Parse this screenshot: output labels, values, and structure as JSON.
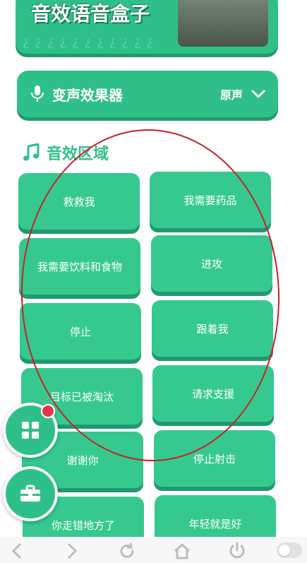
{
  "banner": {
    "title": "音效语音盒子",
    "watermark": "¿¿¿¿¿¿¿¿¿¿¿"
  },
  "voice_changer": {
    "label": "变声效果器",
    "value": "原声"
  },
  "section": {
    "title": "音效区域"
  },
  "sounds": [
    "救救我",
    "我需要药品",
    "我需要饮料和食物",
    "进攻",
    "停止",
    "跟着我",
    "目标已被淘汰",
    "请求支援",
    "谢谢你",
    "停止射击",
    "你走错地方了",
    "年轻就是好"
  ],
  "colors": {
    "accent": "#2fc08a",
    "shadow": "#1f9a6d",
    "badge": "#e8344a",
    "annotation": "#c8202a"
  }
}
